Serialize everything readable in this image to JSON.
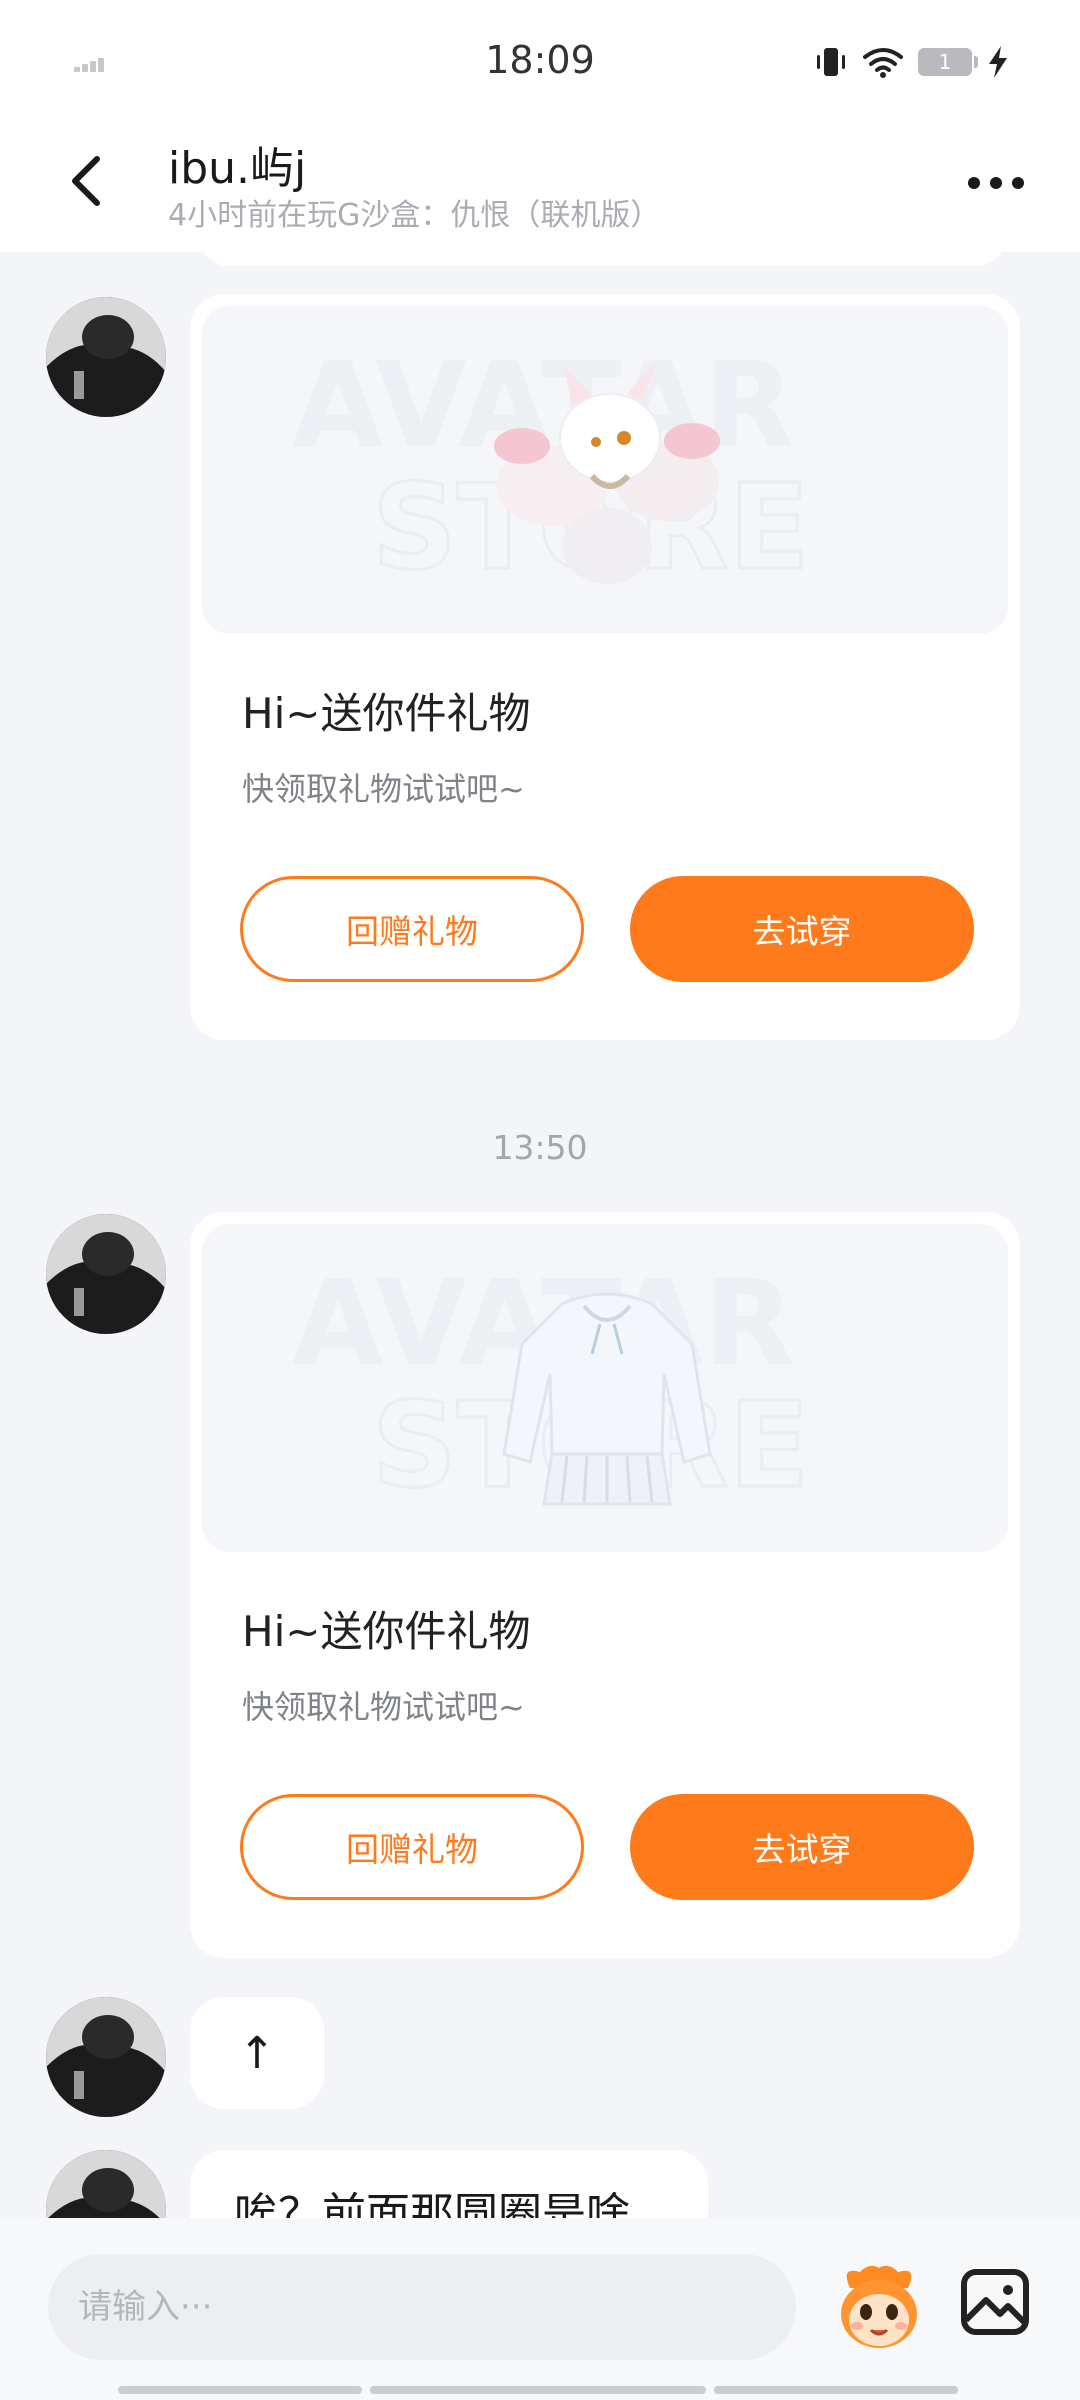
{
  "status_bar": {
    "time": "18:09",
    "battery_level": "1",
    "icons": [
      "signal-icon",
      "vibrate-icon",
      "wifi-icon",
      "battery-icon",
      "charging-icon"
    ]
  },
  "header": {
    "title": "ibu.屿j",
    "subtitle": "4小时前在玩G沙盒：仇恨（联机版）",
    "back_icon": "chevron-left-icon",
    "more_icon": "more-dots-icon"
  },
  "messages": [
    {
      "type": "gift",
      "image_subject": "white nine-tailed fox accessory",
      "watermark_line1": "AVATAR",
      "watermark_line2": "STORE",
      "title": "Hi~送你件礼物",
      "description": "快领取礼物试试吧~",
      "return_gift_label": "回赠礼物",
      "try_on_label": "去试穿"
    },
    {
      "type": "timestamp",
      "text": "13:50"
    },
    {
      "type": "gift",
      "image_subject": "white hoodie with pleated skirt",
      "watermark_line1": "AVATAR",
      "watermark_line2": "STORE",
      "title": "Hi~送你件礼物",
      "description": "快领取礼物试试吧~",
      "return_gift_label": "回赠礼物",
      "try_on_label": "去试穿"
    },
    {
      "type": "text",
      "text": "↑"
    },
    {
      "type": "text",
      "text": "唉？前面那圆圈是啥"
    }
  ],
  "input_bar": {
    "placeholder": "请输入···",
    "mascot_icon": "mascot-emoji-icon",
    "image_icon": "image-picker-icon"
  },
  "colors": {
    "accent": "#ff7a1a",
    "background": "#f3f5f8",
    "card": "#ffffff",
    "muted_text": "#a9adb3"
  }
}
